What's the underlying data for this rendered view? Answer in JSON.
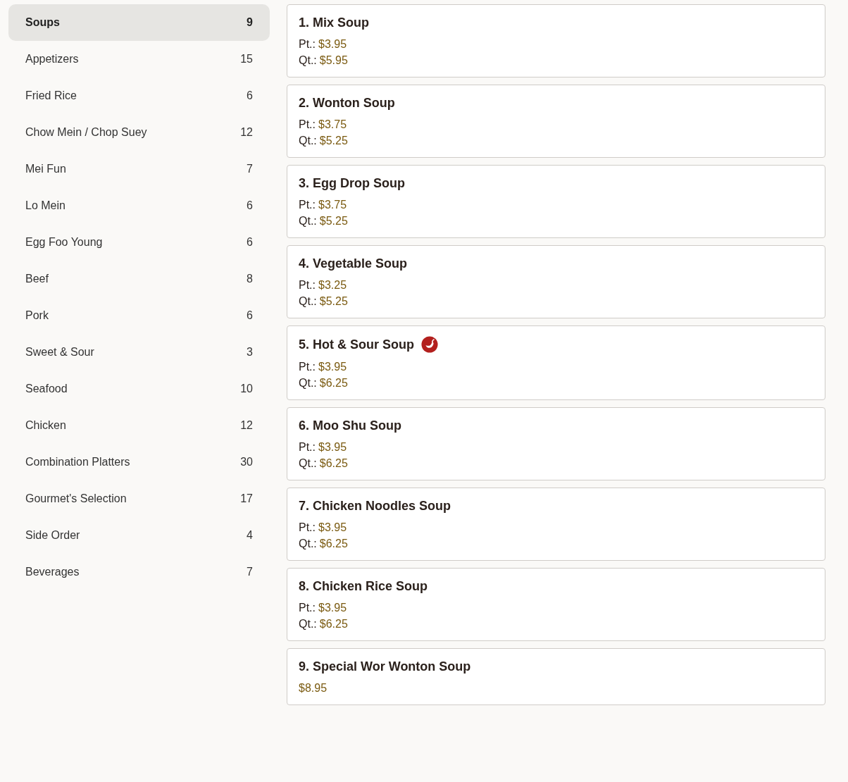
{
  "categories": [
    {
      "name": "Soups",
      "count": "9",
      "selected": true
    },
    {
      "name": "Appetizers",
      "count": "15",
      "selected": false
    },
    {
      "name": "Fried Rice",
      "count": "6",
      "selected": false
    },
    {
      "name": "Chow Mein / Chop Suey",
      "count": "12",
      "selected": false
    },
    {
      "name": "Mei Fun",
      "count": "7",
      "selected": false
    },
    {
      "name": "Lo Mein",
      "count": "6",
      "selected": false
    },
    {
      "name": "Egg Foo Young",
      "count": "6",
      "selected": false
    },
    {
      "name": "Beef",
      "count": "8",
      "selected": false
    },
    {
      "name": "Pork",
      "count": "6",
      "selected": false
    },
    {
      "name": "Sweet & Sour",
      "count": "3",
      "selected": false
    },
    {
      "name": "Seafood",
      "count": "10",
      "selected": false
    },
    {
      "name": "Chicken",
      "count": "12",
      "selected": false
    },
    {
      "name": "Combination Platters",
      "count": "30",
      "selected": false
    },
    {
      "name": "Gourmet's Selection",
      "count": "17",
      "selected": false
    },
    {
      "name": "Side Order",
      "count": "4",
      "selected": false
    },
    {
      "name": "Beverages",
      "count": "7",
      "selected": false
    }
  ],
  "items": [
    {
      "title": "1. Mix Soup",
      "spicy": false,
      "prices": [
        {
          "label": "Pt.:",
          "price": "$3.95"
        },
        {
          "label": "Qt.:",
          "price": "$5.95"
        }
      ]
    },
    {
      "title": "2. Wonton Soup",
      "spicy": false,
      "prices": [
        {
          "label": "Pt.:",
          "price": "$3.75"
        },
        {
          "label": "Qt.:",
          "price": "$5.25"
        }
      ]
    },
    {
      "title": "3. Egg Drop Soup",
      "spicy": false,
      "prices": [
        {
          "label": "Pt.:",
          "price": "$3.75"
        },
        {
          "label": "Qt.:",
          "price": "$5.25"
        }
      ]
    },
    {
      "title": "4. Vegetable Soup",
      "spicy": false,
      "prices": [
        {
          "label": "Pt.:",
          "price": "$3.25"
        },
        {
          "label": "Qt.:",
          "price": "$5.25"
        }
      ]
    },
    {
      "title": "5. Hot & Sour Soup",
      "spicy": true,
      "prices": [
        {
          "label": "Pt.:",
          "price": "$3.95"
        },
        {
          "label": "Qt.:",
          "price": "$6.25"
        }
      ]
    },
    {
      "title": "6. Moo Shu Soup",
      "spicy": false,
      "prices": [
        {
          "label": "Pt.:",
          "price": "$3.95"
        },
        {
          "label": "Qt.:",
          "price": "$6.25"
        }
      ]
    },
    {
      "title": "7. Chicken Noodles Soup",
      "spicy": false,
      "prices": [
        {
          "label": "Pt.:",
          "price": "$3.95"
        },
        {
          "label": "Qt.:",
          "price": "$6.25"
        }
      ]
    },
    {
      "title": "8. Chicken Rice Soup",
      "spicy": false,
      "prices": [
        {
          "label": "Pt.:",
          "price": "$3.95"
        },
        {
          "label": "Qt.:",
          "price": "$6.25"
        }
      ]
    },
    {
      "title": "9. Special Wor Wonton Soup",
      "spicy": false,
      "prices": [
        {
          "price": "$8.95"
        }
      ]
    }
  ]
}
